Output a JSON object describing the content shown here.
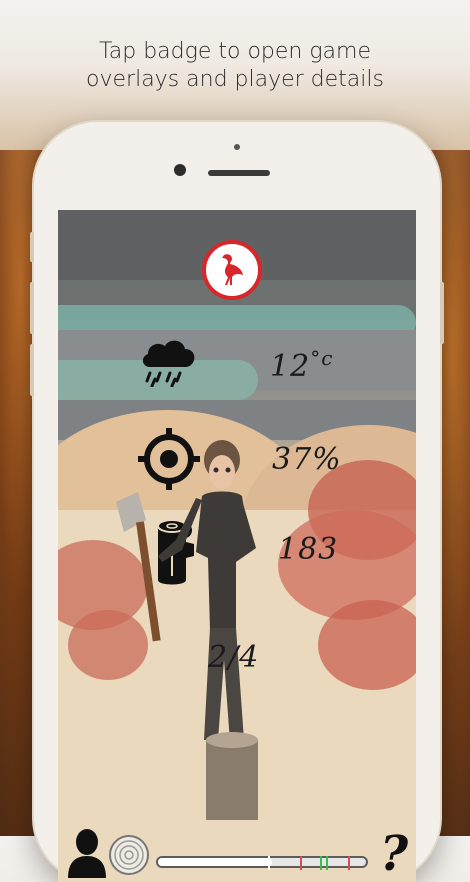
{
  "headline": {
    "line1": "Tap badge to open game",
    "line2": "overlays and player details"
  },
  "game": {
    "badge_icon": "crane-bird-icon",
    "colors": {
      "badge_border": "#d8262a",
      "ink": "#1b1b1b"
    },
    "stats": {
      "temperature_value": "12",
      "temperature_unit": "°c",
      "accuracy": "37%",
      "wood_count": "183",
      "round": "2/4"
    },
    "icons": {
      "weather": "rain-cloud-icon",
      "target": "crosshair-icon",
      "wood": "log-icon",
      "profile": "player-silhouette-icon",
      "stump": "tree-rings-icon",
      "help": "question-mark-icon"
    },
    "help_label": "?",
    "progress": {
      "fill_fraction": 0.55
    }
  }
}
